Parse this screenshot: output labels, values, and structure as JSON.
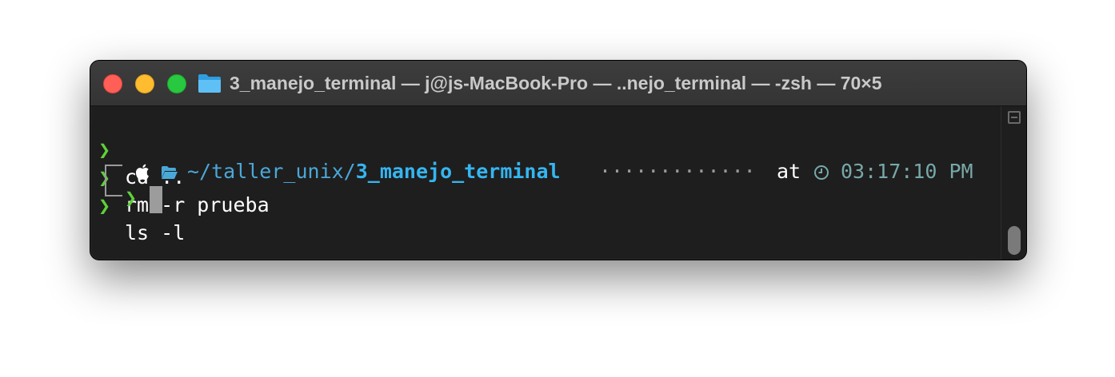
{
  "window": {
    "title": "3_manejo_terminal — j@js-MacBook-Pro — ..nejo_terminal — -zsh — 70×5",
    "folder_icon": "folder-icon"
  },
  "terminal": {
    "prompt_symbol": "❯",
    "history": [
      {
        "command": "cd .."
      },
      {
        "command": "rm -r prueba"
      },
      {
        "command": "ls -l"
      }
    ],
    "status_line": {
      "os_icon": "apple-icon",
      "dir_icon": "open-folder-icon",
      "path_prefix": "~/taller_unix/",
      "path_current": "3_manejo_terminal",
      "filler": "·············",
      "at_label": "at",
      "clock_icon": "clock-icon",
      "time": "03:17:10 PM"
    },
    "input_prompt": "❯"
  },
  "colors": {
    "background": "#1e1e1e",
    "prompt_green": "#5fd03a",
    "path_blue": "#35b6f0",
    "time_teal": "#78a8a8"
  }
}
